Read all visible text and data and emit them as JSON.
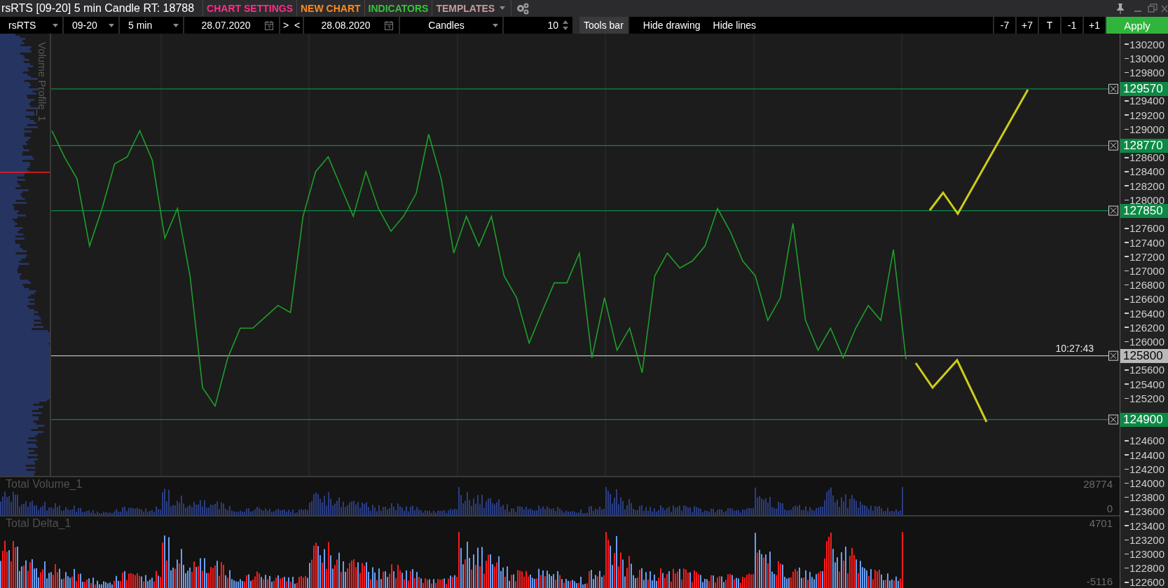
{
  "title_bar": {
    "title": "rsRTS [09-20] 5 min Candle RT: 18788",
    "menu": [
      {
        "label": "CHART SETTINGS",
        "color": "#ff2d8a"
      },
      {
        "label": "NEW CHART",
        "color": "#ff8a1c"
      },
      {
        "label": "INDICATORS",
        "color": "#35c43a"
      },
      {
        "label": "TEMPLATES",
        "color": "#c49a9a"
      }
    ]
  },
  "toolbar": {
    "symbol": "rsRTS",
    "contract": "09-20",
    "timeframe": "5 min",
    "date_from": "28.07.2020",
    "range_buttons": [
      ">",
      "<"
    ],
    "date_to": "28.08.2020",
    "chart_type": "Candles",
    "count": "10",
    "buttons": [
      "Tools bar",
      "Hide drawing",
      "Hide lines"
    ],
    "step_buttons": [
      "-7",
      "+7",
      "T",
      "-1",
      "+1"
    ],
    "apply": "Apply"
  },
  "price_pane": {
    "volume_profile_label": "Volume Profile_1",
    "current_time": "10:27:43",
    "chart_data": {
      "type": "line",
      "ylim": [
        122520,
        130350
      ],
      "yticks": [
        130200,
        130000,
        129800,
        129400,
        129200,
        129000,
        128600,
        128400,
        128200,
        128000,
        127600,
        127400,
        127200,
        127000,
        126800,
        126600,
        126400,
        126200,
        126000,
        125600,
        125400,
        125200,
        124600,
        124400,
        124200,
        124000,
        123800,
        123600,
        123400,
        123200,
        123000,
        122800,
        122600
      ],
      "series": [
        {
          "color": "#1f9e2a",
          "values": [
            128980,
            128610,
            128300,
            127350,
            127880,
            128510,
            128610,
            128980,
            128560,
            127460,
            127880,
            126930,
            125350,
            125090,
            125770,
            126190,
            126190,
            126350,
            126510,
            126410,
            127770,
            128400,
            128610,
            128190,
            127770,
            128400,
            127880,
            127560,
            127770,
            128090,
            128930,
            128300,
            127250,
            127770,
            127350,
            127770,
            126930,
            126620,
            125980,
            126410,
            126830,
            126830,
            127250,
            125770,
            126620,
            125880,
            126190,
            125560,
            126930,
            127250,
            127040,
            127140,
            127350,
            127880,
            127560,
            127140,
            126930,
            126300,
            126620,
            127670,
            126300,
            125880,
            126190,
            125770,
            126190,
            126510,
            126300,
            127300,
            125750
          ]
        }
      ],
      "ref_lines": [
        {
          "axis": "y",
          "value": 129570,
          "label": "129570",
          "color": "#0b8a45"
        },
        {
          "axis": "y",
          "value": 128770,
          "label": "128770",
          "color": "#0b8a45"
        },
        {
          "axis": "y",
          "value": 127850,
          "label": "127850",
          "color": "#0b8a45"
        },
        {
          "axis": "y",
          "value": 125800,
          "label": "125800",
          "color": "#b9b9b9"
        },
        {
          "axis": "y",
          "value": 124900,
          "label": "124900",
          "color": "#0b8a45"
        }
      ]
    }
  },
  "volume_pane": {
    "title": "Total Volume_1",
    "max": "28774",
    "min": "0"
  },
  "delta_pane": {
    "title": "Total Delta_1",
    "max": "4701",
    "min": "-5116"
  }
}
